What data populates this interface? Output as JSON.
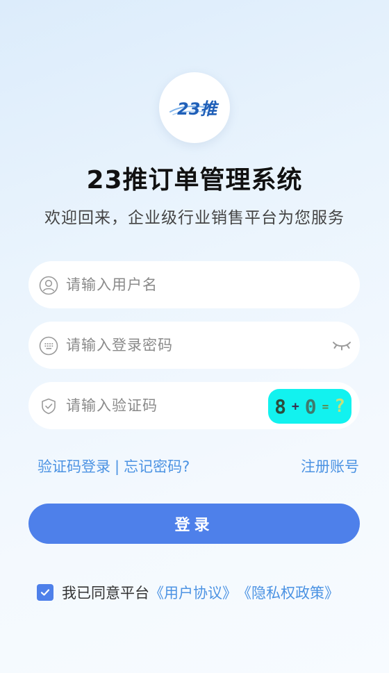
{
  "logo": {
    "text": "23推",
    "brand_color": "#1f5fb8"
  },
  "header": {
    "title": "23推订单管理系统",
    "subtitle": "欢迎回来，企业级行业销售平台为您服务"
  },
  "form": {
    "username": {
      "placeholder": "请输入用户名",
      "icon": "user-icon"
    },
    "password": {
      "placeholder": "请输入登录密码",
      "icon": "keyboard-icon",
      "toggle_icon": "eye-closed-icon"
    },
    "captcha": {
      "placeholder": "请输入验证码",
      "icon": "shield-check-icon",
      "image": {
        "a": "8",
        "op": "+",
        "b": "0",
        "eq": "=",
        "q": "?",
        "background": "#12f2ef"
      }
    }
  },
  "links": {
    "sms_login": "验证码登录",
    "separator": "|",
    "forgot_password": "忘记密码?",
    "register": "注册账号"
  },
  "login_button": {
    "label": "登录"
  },
  "agreement": {
    "checked": true,
    "prefix": "我已同意平台",
    "user_agreement": "《用户协议》",
    "privacy_policy": "《隐私权政策》"
  },
  "colors": {
    "accent": "#4e80ea",
    "link": "#4c93e3"
  }
}
